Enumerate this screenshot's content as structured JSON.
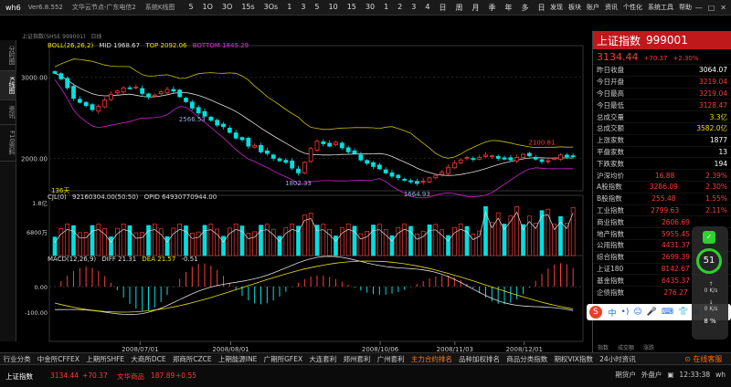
{
  "app": {
    "title": "wh6",
    "version": "Ver6.8.552",
    "source": "文华云节点-广东电信2",
    "view": "系统K线图"
  },
  "periods": [
    "5",
    "1O",
    "3O",
    "15s",
    "3Os",
    "1",
    "3",
    "5",
    "10",
    "15",
    "30",
    "1",
    "2",
    "3",
    "4",
    "日",
    "周",
    "月",
    "季",
    "年",
    "多",
    "日"
  ],
  "top_menu": [
    "发现",
    "板块",
    "账户",
    "资讯",
    "个性化",
    "系统工具",
    "帮助"
  ],
  "left_tabs": [
    "分时图",
    "K线图",
    "资讯",
    "F10资料"
  ],
  "chart_header": {
    "symbol": "上证指数(SHSE 999001)",
    "period": "日线"
  },
  "indicators": {
    "boll": {
      "label": "BOLL(26,26,2)",
      "mid": "MID 1968.67",
      "top": "TOP 2092.06",
      "bottom": "BOTTOM 1845.29"
    },
    "cjl": {
      "label": "CJL(0)",
      "values": "92160304.00(50:50)",
      "opid": "OPID 64930770944.00"
    },
    "macd": {
      "label": "MACD(12,26,9)",
      "diff": "DIFF 21.31",
      "dea": "DEA 21.57",
      "macd": "-0.51"
    }
  },
  "chart_data": [
    {
      "type": "candlestick",
      "title": "上证指数 999001",
      "y_ticks": [
        "3000.00",
        "2000.00"
      ],
      "annotations": [
        "2566.53",
        "1802.33",
        "1664.93",
        "2100.81",
        "136天"
      ],
      "x_labels": [
        "2008/07/01",
        "2008/08/01",
        "2008/10/06",
        "2008/11/03",
        "2008/12/01"
      ],
      "ylim": [
        1600,
        3300
      ],
      "close": [
        3050,
        2980,
        2870,
        2740,
        2690,
        2650,
        2600,
        2640,
        2720,
        2790,
        2830,
        2870,
        2860,
        2880,
        2800,
        2760,
        2780,
        2820,
        2850,
        2830,
        2760,
        2700,
        2620,
        2560,
        2520,
        2470,
        2410,
        2390,
        2320,
        2250,
        2230,
        2150,
        2160,
        2080,
        2060,
        2000,
        1970,
        1950,
        1880,
        1820,
        1950,
        2120,
        2210,
        2180,
        2150,
        2200,
        2130,
        2080,
        2060,
        1980,
        1940,
        1900,
        1870,
        1820,
        1780,
        1760,
        1730,
        1710,
        1690,
        1720,
        1760,
        1790,
        1830,
        1890,
        1940,
        1980,
        2010,
        1990,
        2010,
        2040,
        2030,
        2000,
        1990,
        1980,
        2010,
        2050,
        2030,
        1990,
        1960,
        1970,
        2000,
        2040,
        2020,
        2030
      ]
    },
    {
      "type": "bar",
      "title": "CJL",
      "y_ticks": [
        "1.8亿",
        "6800万"
      ],
      "ylim": [
        0,
        180000000
      ]
    },
    {
      "type": "bar",
      "title": "MACD",
      "y_ticks": [
        "0.00",
        "-100.00"
      ],
      "ylim": [
        -160,
        100
      ]
    }
  ],
  "right_panel": {
    "name": "上证指数",
    "code": "999001",
    "price": "3134.44",
    "change": "+70.37",
    "change_pct": "+2.30%",
    "rows": [
      {
        "k": "昨日收盘",
        "v": "3064.07",
        "c": "white"
      },
      {
        "k": "今日开盘",
        "v": "3219.04",
        "c": "red"
      },
      {
        "k": "今日最高",
        "v": "3219.04",
        "c": "red"
      },
      {
        "k": "今日最低",
        "v": "3128.47",
        "c": "red"
      },
      {
        "k": "总成交量",
        "v": "3.3亿",
        "c": "yellow"
      },
      {
        "k": "总成交额",
        "v": "3582.0亿",
        "c": "yellow"
      },
      {
        "k": "上涨家数",
        "v": "1877",
        "c": "white"
      },
      {
        "k": "平盘家数",
        "v": "13",
        "c": "white"
      },
      {
        "k": "下跌家数",
        "v": "194",
        "c": "white"
      },
      {
        "k": "沪深均价",
        "v": "16.88",
        "v2": "2.39%",
        "c": "red"
      },
      {
        "k": "A股指数",
        "v": "3286.09",
        "v2": "2.30%",
        "c": "red"
      },
      {
        "k": "B股指数",
        "v": "255.48",
        "v2": "1.55%",
        "c": "red"
      },
      {
        "k": "工业指数",
        "v": "2799.63",
        "v2": "2.11%",
        "c": "red"
      },
      {
        "k": "商业指数",
        "v": "2606.69",
        "v2": "",
        "c": "red"
      },
      {
        "k": "地产指数",
        "v": "5955.45",
        "v2": "",
        "c": "red"
      },
      {
        "k": "公用指数",
        "v": "4431.37",
        "v2": "",
        "c": "red"
      },
      {
        "k": "综合指数",
        "v": "2699.39",
        "v2": "",
        "c": "red"
      },
      {
        "k": "上证180",
        "v": "8142.67",
        "v2": "",
        "c": "red"
      },
      {
        "k": "基金指数",
        "v": "6435.37",
        "v2": "",
        "c": "red"
      },
      {
        "k": "企债指数",
        "v": "276.27",
        "v2": "",
        "c": "red"
      }
    ],
    "tabs": [
      "指数",
      "成交额",
      "涨跌"
    ]
  },
  "widget": {
    "score": "51",
    "speed_up": "0 K/s",
    "speed_down": "0 K/s",
    "percent": "8 %"
  },
  "ime": {
    "logo": "S",
    "items": [
      "中",
      "•)",
      "☺",
      "🎤",
      "⌨",
      "👕",
      "⊞"
    ]
  },
  "bottom_tabs": [
    {
      "label": "行业分类",
      "active": false
    },
    {
      "label": "中金所CFFEX",
      "active": false
    },
    {
      "label": "上期所SHFE",
      "active": false
    },
    {
      "label": "大商所DCE",
      "active": false
    },
    {
      "label": "郑商所CZCE",
      "active": false
    },
    {
      "label": "上期能源INE",
      "active": false
    },
    {
      "label": "广期所GFEX",
      "active": false
    },
    {
      "label": "大连套利",
      "active": false
    },
    {
      "label": "郑州套利",
      "active": false
    },
    {
      "label": "广州套利",
      "active": false
    },
    {
      "label": "主力合约排名",
      "active": true
    },
    {
      "label": "品种加权排名",
      "active": false
    },
    {
      "label": "商品分类指数",
      "active": false
    },
    {
      "label": "期权VIX指数",
      "active": false
    },
    {
      "label": "24小时资讯",
      "active": false
    }
  ],
  "bottom_notice": "⊙ 在线客服",
  "status": {
    "idx1_name": "上证指数",
    "idx1_value": "3134.44",
    "idx1_change": "+70.37",
    "idx2_name": "文华商品",
    "idx2_value": "187.89",
    "idx2_change": "+0.55",
    "btn1": "期货户",
    "btn2": "外盘户",
    "time": "12:33:38",
    "user": "wh"
  }
}
